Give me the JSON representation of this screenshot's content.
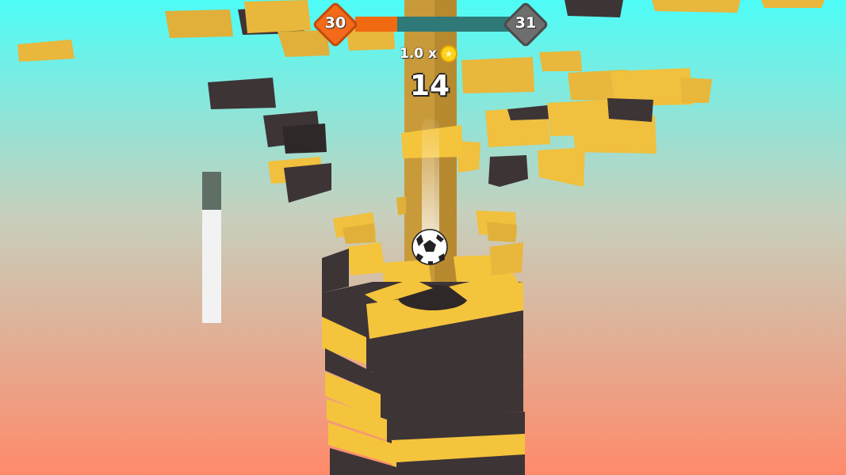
{
  "colors": {
    "sky_top": "#4dfcf7",
    "sky_bottom": "#ff8a6a",
    "block_yellow": "#f4c43c",
    "block_dark": "#3d3436",
    "pillar": "#c99a3a",
    "accent_orange": "#f26a1a"
  },
  "hud": {
    "current_level": "30",
    "next_level": "31",
    "level_progress": 0.27,
    "multiplier": "1.0 x",
    "coin_icon": "star-coin-icon",
    "score": "14",
    "fever_level": 0.25
  }
}
